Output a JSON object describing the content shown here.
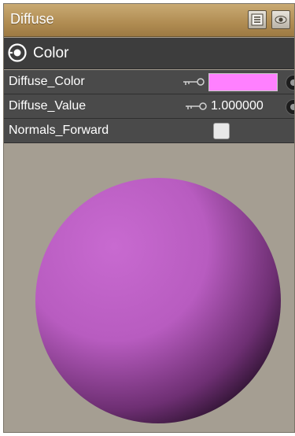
{
  "header": {
    "title": "Diffuse",
    "list_icon": "list-icon",
    "eye_icon": "eye-icon"
  },
  "section": {
    "icon": "eye-target-icon",
    "label": "Color"
  },
  "properties": [
    {
      "label": "Diffuse_Color",
      "type": "color",
      "value": "#ff80ff",
      "key_icon": "key-icon"
    },
    {
      "label": "Diffuse_Value",
      "type": "number",
      "value": "1.000000",
      "key_icon": "key-icon"
    },
    {
      "label": "Normals_Forward",
      "type": "checkbox",
      "checked": false
    }
  ],
  "preview": {
    "icon": "material-sphere-preview",
    "sphere_color": "#b85cc0",
    "background_color": "#a59e92"
  }
}
